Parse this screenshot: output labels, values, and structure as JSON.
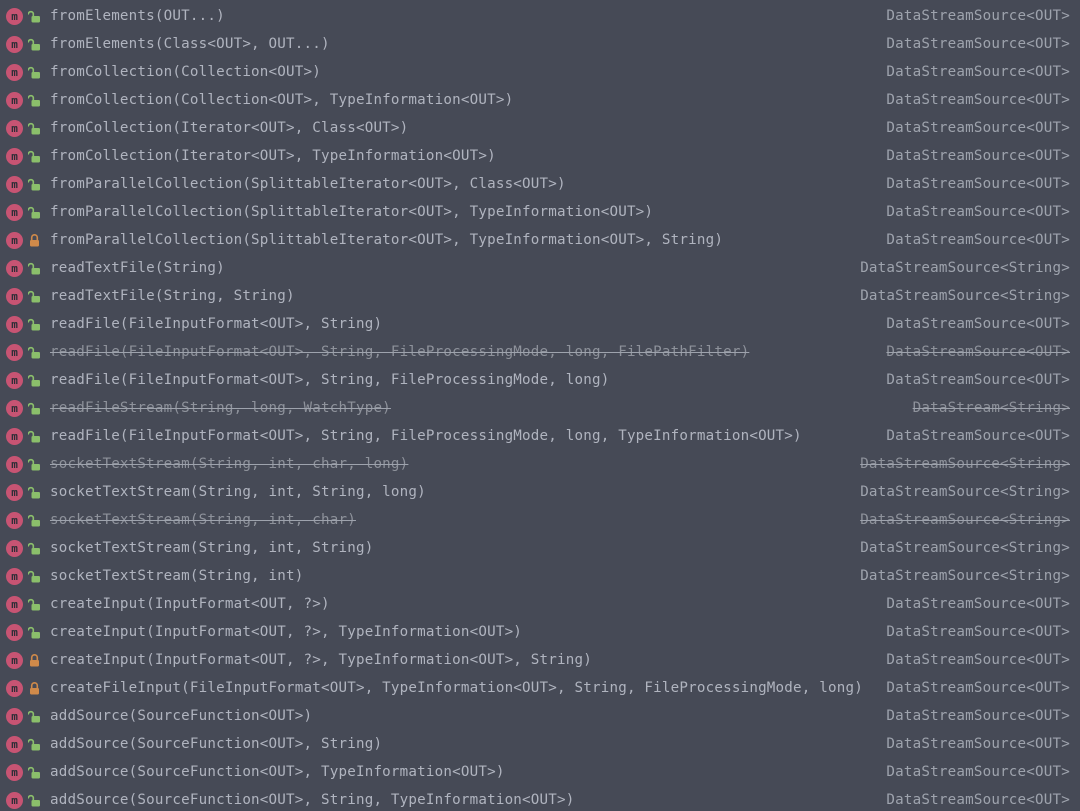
{
  "colors": {
    "lock_open": "#8bbf6b",
    "lock_closed": "#d08a4a",
    "badge": "#c75473"
  },
  "methods": [
    {
      "signature": "fromElements(OUT...)",
      "return": "DataStreamSource<OUT>",
      "access": "open",
      "deprecated": false
    },
    {
      "signature": "fromElements(Class<OUT>, OUT...)",
      "return": "DataStreamSource<OUT>",
      "access": "open",
      "deprecated": false
    },
    {
      "signature": "fromCollection(Collection<OUT>)",
      "return": "DataStreamSource<OUT>",
      "access": "open",
      "deprecated": false
    },
    {
      "signature": "fromCollection(Collection<OUT>, TypeInformation<OUT>)",
      "return": "DataStreamSource<OUT>",
      "access": "open",
      "deprecated": false
    },
    {
      "signature": "fromCollection(Iterator<OUT>, Class<OUT>)",
      "return": "DataStreamSource<OUT>",
      "access": "open",
      "deprecated": false
    },
    {
      "signature": "fromCollection(Iterator<OUT>, TypeInformation<OUT>)",
      "return": "DataStreamSource<OUT>",
      "access": "open",
      "deprecated": false
    },
    {
      "signature": "fromParallelCollection(SplittableIterator<OUT>, Class<OUT>)",
      "return": "DataStreamSource<OUT>",
      "access": "open",
      "deprecated": false
    },
    {
      "signature": "fromParallelCollection(SplittableIterator<OUT>, TypeInformation<OUT>)",
      "return": "DataStreamSource<OUT>",
      "access": "open",
      "deprecated": false
    },
    {
      "signature": "fromParallelCollection(SplittableIterator<OUT>, TypeInformation<OUT>, String)",
      "return": "DataStreamSource<OUT>",
      "access": "closed",
      "deprecated": false
    },
    {
      "signature": "readTextFile(String)",
      "return": "DataStreamSource<String>",
      "access": "open",
      "deprecated": false
    },
    {
      "signature": "readTextFile(String, String)",
      "return": "DataStreamSource<String>",
      "access": "open",
      "deprecated": false
    },
    {
      "signature": "readFile(FileInputFormat<OUT>, String)",
      "return": "DataStreamSource<OUT>",
      "access": "open",
      "deprecated": false
    },
    {
      "signature": "readFile(FileInputFormat<OUT>, String, FileProcessingMode, long, FilePathFilter)",
      "return": "DataStreamSource<OUT>",
      "access": "open",
      "deprecated": true
    },
    {
      "signature": "readFile(FileInputFormat<OUT>, String, FileProcessingMode, long)",
      "return": "DataStreamSource<OUT>",
      "access": "open",
      "deprecated": false
    },
    {
      "signature": "readFileStream(String, long, WatchType)",
      "return": "DataStream<String>",
      "access": "open",
      "deprecated": true
    },
    {
      "signature": "readFile(FileInputFormat<OUT>, String, FileProcessingMode, long, TypeInformation<OUT>)",
      "return": "DataStreamSource<OUT>",
      "access": "open",
      "deprecated": false
    },
    {
      "signature": "socketTextStream(String, int, char, long)",
      "return": "DataStreamSource<String>",
      "access": "open",
      "deprecated": true
    },
    {
      "signature": "socketTextStream(String, int, String, long)",
      "return": "DataStreamSource<String>",
      "access": "open",
      "deprecated": false
    },
    {
      "signature": "socketTextStream(String, int, char)",
      "return": "DataStreamSource<String>",
      "access": "open",
      "deprecated": true
    },
    {
      "signature": "socketTextStream(String, int, String)",
      "return": "DataStreamSource<String>",
      "access": "open",
      "deprecated": false
    },
    {
      "signature": "socketTextStream(String, int)",
      "return": "DataStreamSource<String>",
      "access": "open",
      "deprecated": false
    },
    {
      "signature": "createInput(InputFormat<OUT, ?>)",
      "return": "DataStreamSource<OUT>",
      "access": "open",
      "deprecated": false
    },
    {
      "signature": "createInput(InputFormat<OUT, ?>, TypeInformation<OUT>)",
      "return": "DataStreamSource<OUT>",
      "access": "open",
      "deprecated": false
    },
    {
      "signature": "createInput(InputFormat<OUT, ?>, TypeInformation<OUT>, String)",
      "return": "DataStreamSource<OUT>",
      "access": "closed",
      "deprecated": false
    },
    {
      "signature": "createFileInput(FileInputFormat<OUT>, TypeInformation<OUT>, String, FileProcessingMode, long)",
      "return": "DataStreamSource<OUT>",
      "access": "closed",
      "deprecated": false
    },
    {
      "signature": "addSource(SourceFunction<OUT>)",
      "return": "DataStreamSource<OUT>",
      "access": "open",
      "deprecated": false
    },
    {
      "signature": "addSource(SourceFunction<OUT>, String)",
      "return": "DataStreamSource<OUT>",
      "access": "open",
      "deprecated": false
    },
    {
      "signature": "addSource(SourceFunction<OUT>, TypeInformation<OUT>)",
      "return": "DataStreamSource<OUT>",
      "access": "open",
      "deprecated": false
    },
    {
      "signature": "addSource(SourceFunction<OUT>, String, TypeInformation<OUT>)",
      "return": "DataStreamSource<OUT>",
      "access": "open",
      "deprecated": false
    }
  ]
}
